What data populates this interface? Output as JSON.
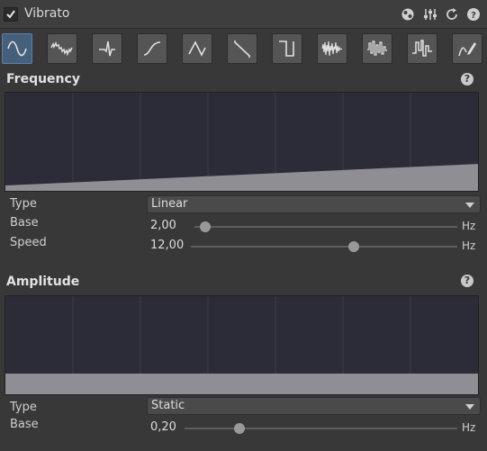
{
  "header": {
    "title": "Vibrato",
    "enabled": true,
    "icons": [
      "preset-icon",
      "settings-sliders-icon",
      "reset-icon",
      "help-icon"
    ]
  },
  "waveforms": [
    {
      "name": "sine-wave-icon",
      "selected": true
    },
    {
      "name": "noisy-sine-icon",
      "selected": false
    },
    {
      "name": "spike-icon",
      "selected": false
    },
    {
      "name": "s-curve-icon",
      "selected": false
    },
    {
      "name": "triangle-wave-icon",
      "selected": false
    },
    {
      "name": "sawtooth-wave-icon",
      "selected": false
    },
    {
      "name": "square-wave-icon",
      "selected": false
    },
    {
      "name": "noise-icon",
      "selected": false
    },
    {
      "name": "random-noise-icon",
      "selected": false
    },
    {
      "name": "step-noise-icon",
      "selected": false
    },
    {
      "name": "custom-curve-icon",
      "selected": false
    }
  ],
  "frequency": {
    "title": "Frequency",
    "help": "?",
    "type_label": "Type",
    "type_value": "Linear",
    "base_label": "Base",
    "base_value": "2,00",
    "base_fraction": 0.04,
    "base_unit": "Hz",
    "speed_label": "Speed",
    "speed_value": "12,00",
    "speed_fraction": 0.61,
    "speed_unit": "Hz"
  },
  "amplitude": {
    "title": "Amplitude",
    "help": "?",
    "type_label": "Type",
    "type_value": "Static",
    "base_label": "Base",
    "base_value": "0,20",
    "base_fraction": 0.2,
    "base_unit": "Hz"
  },
  "colors": {
    "selected_button": "#46607c",
    "curve_fill": "#8e8e94",
    "curve_bg": "#2c2c38"
  }
}
